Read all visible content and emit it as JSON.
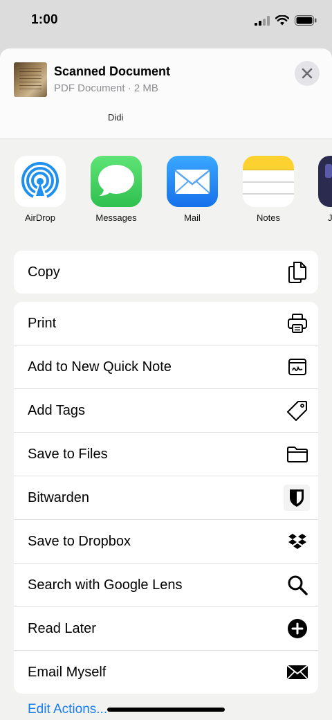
{
  "status_bar": {
    "time": "1:00"
  },
  "header": {
    "title": "Scanned Document",
    "subtitle": "PDF Document · 2 MB"
  },
  "people": [
    {
      "name": "Didi"
    }
  ],
  "apps": [
    {
      "label": "AirDrop",
      "icon": "airdrop-icon"
    },
    {
      "label": "Messages",
      "icon": "messages-icon"
    },
    {
      "label": "Mail",
      "icon": "mail-icon"
    },
    {
      "label": "Notes",
      "icon": "notes-icon"
    },
    {
      "label": "J",
      "icon": "app-icon"
    }
  ],
  "actions_top": [
    {
      "label": "Copy",
      "icon": "copy-icon"
    }
  ],
  "actions": [
    {
      "label": "Print",
      "icon": "printer-icon"
    },
    {
      "label": "Add to New Quick Note",
      "icon": "quick-note-icon"
    },
    {
      "label": "Add Tags",
      "icon": "tag-icon"
    },
    {
      "label": "Save to Files",
      "icon": "folder-icon"
    },
    {
      "label": "Bitwarden",
      "icon": "shield-icon"
    },
    {
      "label": "Save to Dropbox",
      "icon": "dropbox-icon"
    },
    {
      "label": "Search with Google Lens",
      "icon": "search-icon"
    },
    {
      "label": "Read Later",
      "icon": "plus-circle-icon"
    },
    {
      "label": "Email Myself",
      "icon": "envelope-icon"
    }
  ],
  "edit_actions_label": "Edit Actions...",
  "colors": {
    "accent": "#1a7cf0",
    "sheet_bg": "#f2f2f1",
    "airdrop": "#1f90ee",
    "messages": "#35c759",
    "mail": "#1b86f2"
  }
}
